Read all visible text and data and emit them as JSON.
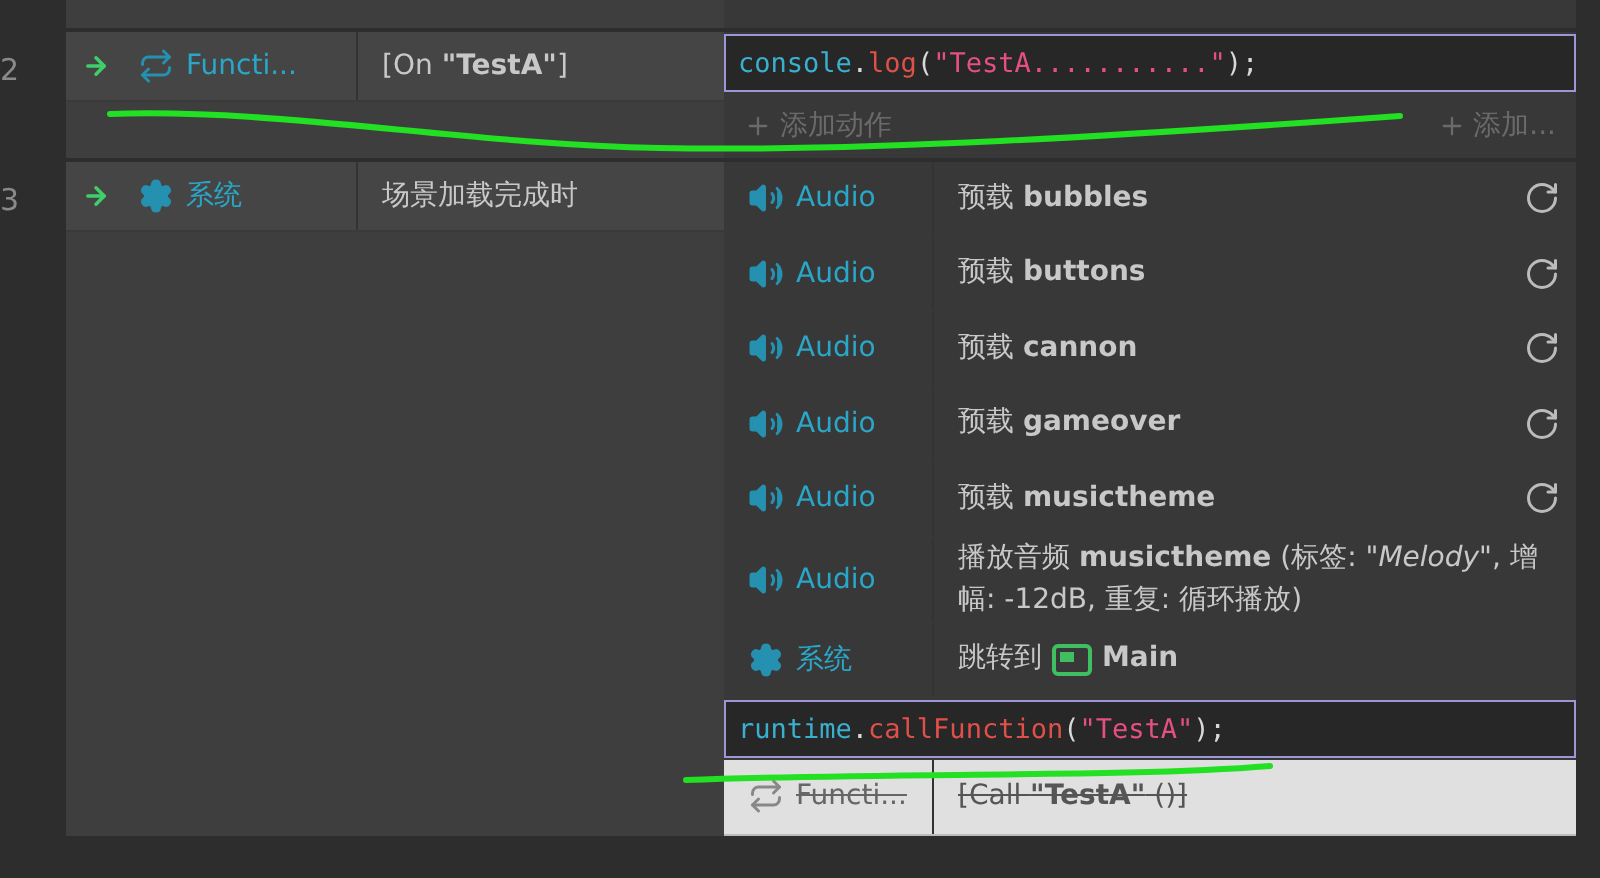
{
  "events": [
    {
      "line": "2",
      "conditions": [
        {
          "kind": "function",
          "object": "Functi...",
          "text": "[On **\"TestA\"**]"
        }
      ],
      "actions": [
        {
          "kind": "code",
          "tokens": [
            {
              "kind": "ident",
              "text": "console"
            },
            {
              "kind": "punct",
              "text": "."
            },
            {
              "kind": "method",
              "text": "log"
            },
            {
              "kind": "punct",
              "text": "("
            },
            {
              "kind": "string",
              "text": "\"TestA...........\""
            },
            {
              "kind": "punct",
              "text": ");"
            }
          ]
        },
        {
          "kind": "add",
          "label": "添加动作",
          "more": "添加..."
        }
      ]
    },
    {
      "line": "3",
      "conditions": [
        {
          "kind": "system",
          "object": "系统",
          "text": "场景加载完成时"
        }
      ],
      "actions": [
        {
          "kind": "audio",
          "object": "Audio",
          "text": "预载 **bubbles**",
          "timer": true,
          "disabled": false
        },
        {
          "kind": "audio",
          "object": "Audio",
          "text": "预载 **buttons**",
          "timer": true,
          "disabled": false
        },
        {
          "kind": "audio",
          "object": "Audio",
          "text": "预载 **cannon**",
          "timer": true,
          "disabled": false
        },
        {
          "kind": "audio",
          "object": "Audio",
          "text": "预载 **gameover**",
          "timer": true,
          "disabled": false
        },
        {
          "kind": "audio",
          "object": "Audio",
          "text": "预载 **musictheme**",
          "timer": true,
          "disabled": false
        },
        {
          "kind": "audio",
          "object": "Audio",
          "text": "播放音频 **musictheme** (标签: *\"Melody\"*, 增幅: -12dB, 重复: 循环播放)",
          "timer": false,
          "disabled": false
        },
        {
          "kind": "system",
          "object": "系统",
          "text": "跳转到",
          "layout": "Main",
          "timer": false,
          "disabled": false
        },
        {
          "kind": "code",
          "tokens": [
            {
              "kind": "ident",
              "text": "runtime"
            },
            {
              "kind": "punct",
              "text": "."
            },
            {
              "kind": "method",
              "text": "callFunction"
            },
            {
              "kind": "punct",
              "text": "("
            },
            {
              "kind": "string",
              "text": "\"TestA\""
            },
            {
              "kind": "punct",
              "text": ");"
            }
          ]
        },
        {
          "kind": "function",
          "object": "Functi...",
          "text": "[Call **\"TestA\"** ()]",
          "timer": false,
          "disabled": true
        }
      ]
    }
  ]
}
